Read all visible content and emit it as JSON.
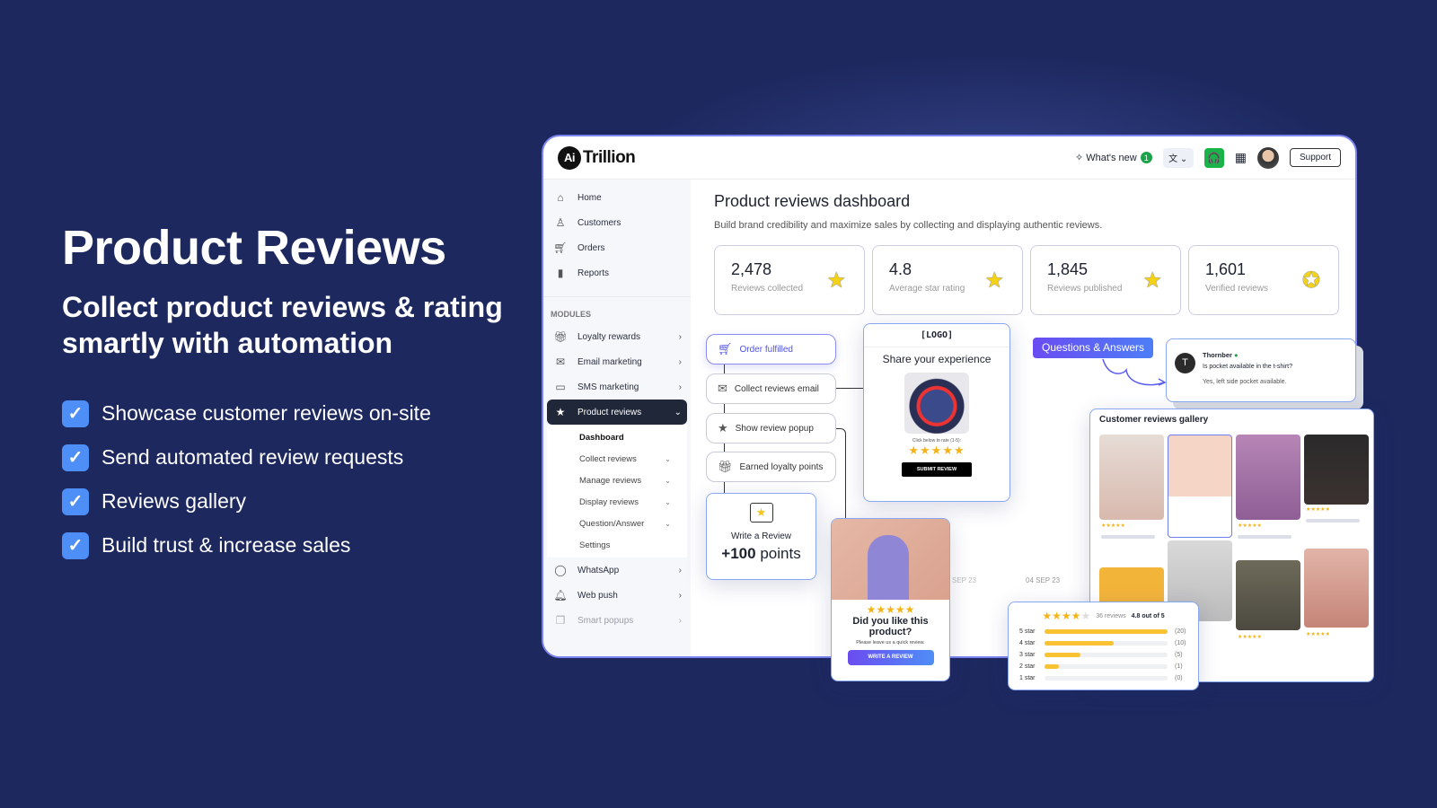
{
  "hero": {
    "title": "Product Reviews",
    "subtitle": "Collect product reviews & rating smartly with automation",
    "bullets": [
      "Showcase customer reviews on-site",
      "Send automated review requests",
      "Reviews gallery",
      "Build trust & increase sales"
    ]
  },
  "header": {
    "logo_ai": "Ai",
    "logo_text": "Trillion",
    "whats_new": "What's new",
    "whats_new_count": "1",
    "support": "Support"
  },
  "sidebar": {
    "items": [
      {
        "label": "Home",
        "icon": "home-icon"
      },
      {
        "label": "Customers",
        "icon": "user-icon"
      },
      {
        "label": "Orders",
        "icon": "cart-icon"
      },
      {
        "label": "Reports",
        "icon": "bar-chart-icon"
      }
    ],
    "modules_label": "MODULES",
    "modules": [
      {
        "label": "Loyalty rewards"
      },
      {
        "label": "Email marketing"
      },
      {
        "label": "SMS marketing"
      },
      {
        "label": "Product reviews",
        "active": true
      }
    ],
    "subitems": [
      "Dashboard",
      "Collect reviews",
      "Manage reviews",
      "Display reviews",
      "Question/Answer",
      "Settings"
    ],
    "more": [
      {
        "label": "WhatsApp"
      },
      {
        "label": "Web push"
      },
      {
        "label": "Smart popups"
      }
    ]
  },
  "main": {
    "title": "Product reviews dashboard",
    "description": "Build brand credibility and maximize sales by collecting and displaying authentic reviews.",
    "stats": [
      {
        "value": "2,478",
        "label": "Reviews collected"
      },
      {
        "value": "4.8",
        "label": "Average star rating"
      },
      {
        "value": "1,845",
        "label": "Reviews published"
      },
      {
        "value": "1,601",
        "label": "Verified reviews"
      }
    ],
    "date_labels": [
      "SEP 23",
      "04 SEP 23"
    ]
  },
  "flow": {
    "steps": [
      "Order fulfilled",
      "Collect reviews email",
      "Show review popup",
      "Earned loyalty points"
    ],
    "reward_title": "Write a Review",
    "reward_points": "+100",
    "reward_unit": "points"
  },
  "email_card": {
    "logo": "[LOGO]",
    "title": "Share your experience",
    "rate_prompt": "Click below to rate (1-5):",
    "submit": "SUBMIT REVIEW"
  },
  "popup": {
    "title": "Did you like this product?",
    "subtitle": "Please leave us a quick review.",
    "button": "WRITE A REVIEW"
  },
  "qa": {
    "badge": "Questions & Answers",
    "avatar": "T",
    "name": "Thornber",
    "question": "Is pocket available in the t-shirt?",
    "answer": "Yes, left side pocket available."
  },
  "gallery": {
    "title": "Customer reviews gallery"
  },
  "summary": {
    "count": "36 reviews",
    "score": "4.8 out of 5",
    "rating_stars": 4,
    "rows": [
      {
        "label": "5 star",
        "count": "(20)",
        "pct": 100
      },
      {
        "label": "4 star",
        "count": "(10)",
        "pct": 56
      },
      {
        "label": "3 star",
        "count": "(5)",
        "pct": 29
      },
      {
        "label": "2 star",
        "count": "(1)",
        "pct": 12
      },
      {
        "label": "1 star",
        "count": "(0)",
        "pct": 0
      }
    ]
  },
  "colors": {
    "background": "#1d285f",
    "accent": "#5b5ef0",
    "star": "#f5b318",
    "check": "#4d8ef7"
  }
}
